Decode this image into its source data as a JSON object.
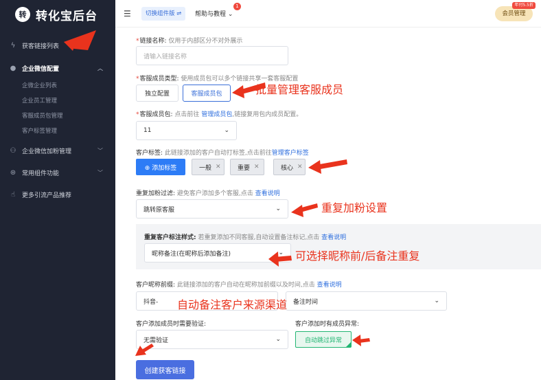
{
  "app": {
    "logo_char": "转",
    "title": "转化宝后台"
  },
  "sidebar": {
    "items": [
      {
        "label": "获客链接列表",
        "icon": "bolt-icon"
      },
      {
        "label": "企业微信配置",
        "icon": "wechat-icon"
      },
      {
        "label": "企业微信加粉管理",
        "icon": "users-icon"
      },
      {
        "label": "常用组件功能",
        "icon": "component-icon"
      },
      {
        "label": "更多引流产品推荐",
        "icon": "thumb-up-icon"
      }
    ],
    "sub_items": [
      "企微企业列表",
      "企业员工管理",
      "客服成员包管理",
      "客户标签管理"
    ]
  },
  "topbar": {
    "switch_label": "切换组件版 ⇌",
    "help_label": "帮助与教程",
    "help_badge": "1",
    "member_label": "会员管理",
    "member_tag": "年付5.5折"
  },
  "form": {
    "link_name": {
      "label": "链接名称:",
      "hint": "仅用于内部区分不对外展示",
      "placeholder": "请输入链接名称"
    },
    "member_type": {
      "label": "客服成员类型:",
      "hint": "使用成员包可以多个链接共享一套客服配置",
      "option_independent": "独立配置",
      "option_pack": "客服成员包"
    },
    "member_pack": {
      "label": "客服成员包:",
      "hint_pre": "点击前往",
      "hint_link": "管理成员包",
      "hint_post": ",链接复用包内成员配置。",
      "value": "11"
    },
    "customer_tags": {
      "label": "客户标签:",
      "hint": "此链接添加的客户自动打标签,点击前往",
      "hint_link": "管理客户标签",
      "add_label": "⊕ 添加标签",
      "tags": [
        "一般",
        "重要",
        "核心"
      ]
    },
    "dup_filter": {
      "label": "重复加粉过滤:",
      "hint": "避免客户添加多个客服,点击",
      "hint_link": "查看说明",
      "value": "跳转原客服"
    },
    "dup_mark": {
      "label": "重复客户标注样式:",
      "hint": "若重复添加不同客服,自动设置备注标记,点击",
      "hint_link": "查看说明",
      "value": "昵称备注(在昵称后添加备注)"
    },
    "nickname_prefix": {
      "label": "客户昵称前缀:",
      "hint": "此链接添加的客户自动在昵称加前缀以及时间,点击",
      "hint_link": "查看说明",
      "value": "抖音-",
      "time_value": "备注时间"
    },
    "verify": {
      "label": "客户添加成员时需要验证:",
      "value": "无需验证"
    },
    "abnormal": {
      "label": "客户添加时有成员异常:",
      "value": "自动跳过异常"
    },
    "submit_label": "创建获客链接"
  },
  "annotations": {
    "batch": "批量管理客服成员",
    "repeat": "重复加粉设置",
    "position": "可选择昵称前/后备注重复",
    "source": "自动备注客户来源渠道"
  },
  "colors": {
    "accent": "#2d7cf6",
    "annotation": "#e9331d",
    "sidebar_bg": "#1f2433",
    "success": "#22b573"
  }
}
